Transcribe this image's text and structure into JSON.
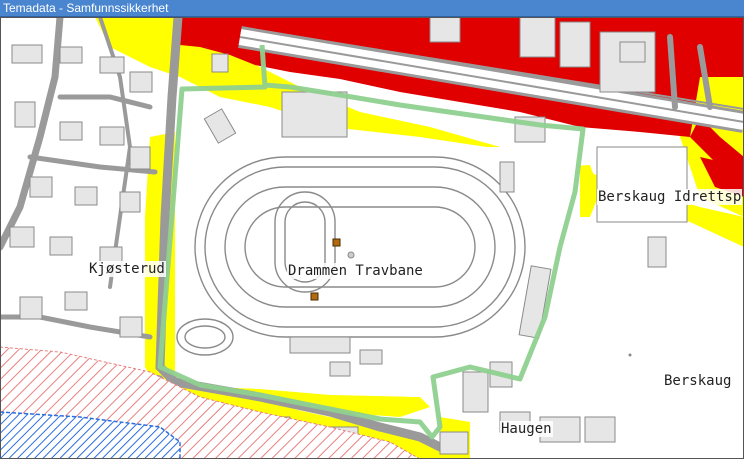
{
  "window": {
    "title": "Temadata - Samfunnssikkerhet"
  },
  "map": {
    "labels": {
      "travbane": "Drammen Travbane",
      "kjosterud": "Kjøsterud",
      "idrett": "Berskaug Idrettsp",
      "berskaug": "Berskaug",
      "haugen": "Haugen"
    },
    "colors": {
      "hazard_high": "#e00000",
      "hazard_medium": "#ffff00",
      "boundary": "#8fd08f",
      "road": "#9a9a9a",
      "building": "#e6e6e6",
      "hatch": "#e88080",
      "blue_hatch": "#2a6ee0",
      "marker": "#b06a10"
    }
  }
}
